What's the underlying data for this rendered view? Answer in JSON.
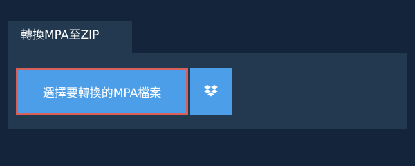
{
  "tab": {
    "title": "轉換MPA至ZIP"
  },
  "upload": {
    "select_label": "選擇要轉換的MPA檔案"
  },
  "icons": {
    "dropbox": "dropbox-icon"
  },
  "colors": {
    "background": "#14253b",
    "panel": "#233950",
    "button": "#4c9ee8",
    "highlight": "#d9605a"
  }
}
